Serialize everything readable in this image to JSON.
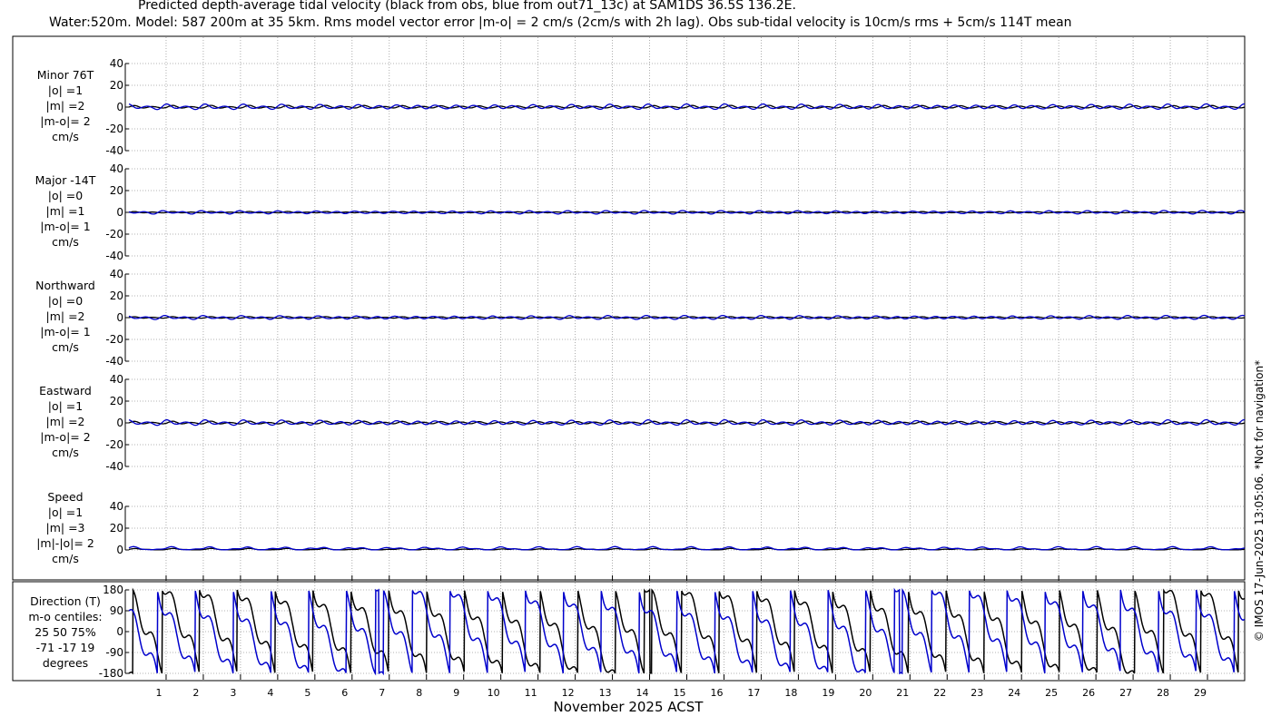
{
  "title": {
    "line1": "Predicted depth-average tidal velocity (black from obs, blue from out71_13c) at SAM1DS 36.5S 136.2E.",
    "line2": "Water:520m. Model: 587 200m at 35 5km. Rms model vector error |m-o| = 2 cm/s (2cm/s with 2h lag). Obs sub-tidal velocity is 10cm/s rms + 5cm/s 114T mean"
  },
  "xlabel": "November 2025 ACST",
  "copyright": "© IMOS 17-Jun-2025 13:05:06. *Not for navigation*",
  "colors": {
    "obs": "#000000",
    "model": "#0000cc",
    "grid": "#9a9a9a"
  },
  "chart_data": [
    {
      "type": "line",
      "panel": "Minor 76T",
      "side_label": [
        "Minor 76T",
        "|o| =1",
        "|m| =2",
        "|m-o|= 2",
        "cm/s"
      ],
      "ylim": [
        -40,
        40
      ],
      "yticks": [
        40,
        20,
        0,
        -20,
        -40
      ],
      "xlim": [
        0,
        30
      ],
      "series": [
        {
          "name": "obs",
          "kind": "tidal",
          "amp": 1.2,
          "phase": 0.0
        },
        {
          "name": "model",
          "kind": "tidal",
          "amp": 2.2,
          "phase": 0.3
        }
      ]
    },
    {
      "type": "line",
      "panel": "Major -14T",
      "side_label": [
        "Major -14T",
        "|o| =0",
        "|m| =1",
        "|m-o|= 1",
        "cm/s"
      ],
      "ylim": [
        -40,
        40
      ],
      "yticks": [
        40,
        20,
        0,
        -20,
        -40
      ],
      "xlim": [
        0,
        30
      ],
      "series": [
        {
          "name": "obs",
          "kind": "tidal",
          "amp": 0.6,
          "phase": 0.0
        },
        {
          "name": "model",
          "kind": "tidal",
          "amp": 1.4,
          "phase": 0.5
        }
      ]
    },
    {
      "type": "line",
      "panel": "Northward",
      "side_label": [
        "Northward",
        "|o| =0",
        "|m| =2",
        "|m-o|= 1",
        "cm/s"
      ],
      "ylim": [
        -40,
        40
      ],
      "yticks": [
        40,
        20,
        0,
        -20,
        -40
      ],
      "xlim": [
        0,
        30
      ],
      "series": [
        {
          "name": "obs",
          "kind": "tidal",
          "amp": 0.7,
          "phase": 0.0
        },
        {
          "name": "model",
          "kind": "tidal",
          "amp": 1.6,
          "phase": 0.4
        }
      ]
    },
    {
      "type": "line",
      "panel": "Eastward",
      "side_label": [
        "Eastward",
        "|o| =1",
        "|m| =2",
        "|m-o|= 2",
        "cm/s"
      ],
      "ylim": [
        -40,
        40
      ],
      "yticks": [
        40,
        20,
        0,
        -20,
        -40
      ],
      "xlim": [
        0,
        30
      ],
      "series": [
        {
          "name": "obs",
          "kind": "tidal",
          "amp": 1.2,
          "phase": 0.0
        },
        {
          "name": "model",
          "kind": "tidal",
          "amp": 2.2,
          "phase": 0.3
        }
      ]
    },
    {
      "type": "line",
      "panel": "Speed",
      "side_label": [
        "Speed",
        "|o| =1",
        "|m| =3",
        "|m|-|o|= 2",
        "cm/s"
      ],
      "ylim": [
        0,
        40
      ],
      "yticks": [
        40,
        20,
        0
      ],
      "xlim": [
        0,
        30
      ],
      "series": [
        {
          "name": "obs",
          "kind": "speed",
          "amp": 1.3,
          "phase": 0.0
        },
        {
          "name": "model",
          "kind": "speed",
          "amp": 2.8,
          "phase": 0.3
        }
      ]
    },
    {
      "type": "line",
      "panel": "Direction (T)",
      "side_label": [
        "Direction (T)",
        "m-o centiles:",
        "25  50  75%",
        "-71  -17  19",
        "degrees"
      ],
      "ylim": [
        -180,
        180
      ],
      "yticks": [
        180,
        90,
        0,
        -90,
        -180
      ],
      "xlim": [
        0,
        30
      ],
      "series": [
        {
          "name": "obs",
          "kind": "direction",
          "phase": 0.0
        },
        {
          "name": "model",
          "kind": "direction",
          "phase": 0.25
        }
      ]
    }
  ],
  "xticks": [
    "1",
    "2",
    "3",
    "4",
    "5",
    "6",
    "7",
    "8",
    "9",
    "10",
    "11",
    "12",
    "13",
    "14",
    "15",
    "16",
    "17",
    "18",
    "19",
    "20",
    "21",
    "22",
    "23",
    "24",
    "25",
    "26",
    "27",
    "28",
    "29"
  ]
}
